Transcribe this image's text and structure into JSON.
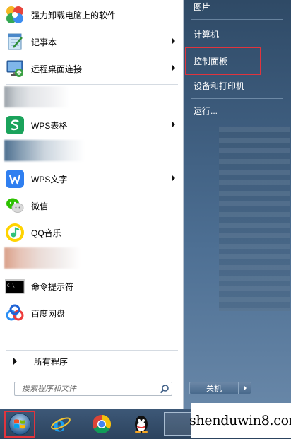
{
  "start_menu": {
    "programs": [
      {
        "label": "强力卸载电脑上的软件",
        "icon": "uninstaller-icon",
        "has_submenu": false
      },
      {
        "label": "记事本",
        "icon": "notepad-icon",
        "has_submenu": true
      },
      {
        "label": "远程桌面连接",
        "icon": "remote-desktop-icon",
        "has_submenu": true
      },
      {
        "label": "WPS表格",
        "icon": "wps-spreadsheet-icon",
        "has_submenu": true
      },
      {
        "label": "WPS文字",
        "icon": "wps-writer-icon",
        "has_submenu": true
      },
      {
        "label": "微信",
        "icon": "wechat-icon",
        "has_submenu": false
      },
      {
        "label": "QQ音乐",
        "icon": "qq-music-icon",
        "has_submenu": false
      },
      {
        "label": "命令提示符",
        "icon": "command-prompt-icon",
        "has_submenu": false
      },
      {
        "label": "百度网盘",
        "icon": "baidu-netdisk-icon",
        "has_submenu": false
      }
    ],
    "all_programs_label": "所有程序",
    "search_placeholder": "搜索程序和文件",
    "right_items": [
      {
        "label": "图片"
      },
      {
        "label": "计算机"
      },
      {
        "label": "控制面板"
      },
      {
        "label": "设备和打印机"
      },
      {
        "label": "运行..."
      }
    ],
    "shutdown_label": "关机",
    "highlighted_item": "控制面板"
  },
  "taskbar": {
    "pinned": [
      {
        "name": "internet-explorer-icon"
      },
      {
        "name": "chrome-icon"
      },
      {
        "name": "qq-icon"
      }
    ]
  },
  "watermark": {
    "text": "shenduwin8.com"
  },
  "colors": {
    "highlight_border": "#e1343d",
    "right_pane": "#3d5c7d",
    "taskbar": "#2c435e"
  }
}
